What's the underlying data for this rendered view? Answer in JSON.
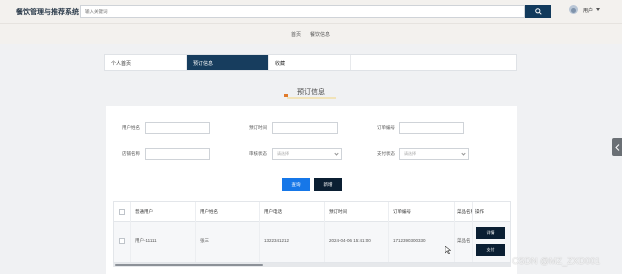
{
  "app": {
    "title": "餐饮管理与推荐系统"
  },
  "search": {
    "placeholder": "输入关键词"
  },
  "user": {
    "name": "用户"
  },
  "nav": {
    "home": "首页",
    "food_info": "餐饮信息"
  },
  "tabs": [
    {
      "label": "个人首页",
      "active": false
    },
    {
      "label": "预订信息",
      "active": true
    },
    {
      "label": "收藏",
      "active": false
    }
  ],
  "section": {
    "title": "预订信息"
  },
  "filters": {
    "username_label": "用户姓名",
    "booking_time_label": "预订时间",
    "order_no_label": "订单编号",
    "restaurant_label": "店铺名称",
    "review_status_label": "审核状态",
    "review_status_placeholder": "请选择",
    "pay_status_label": "支付状态",
    "pay_status_placeholder": "请选择"
  },
  "buttons": {
    "query": "查询",
    "add": "新增"
  },
  "table": {
    "columns": [
      "普通用户",
      "用户姓名",
      "用户电话",
      "预订时间",
      "订单编号",
      "菜品名称",
      "操作"
    ],
    "rows": [
      {
        "user": "用户-11111",
        "name": "张三",
        "phone": "1322341212",
        "time": "2024-04-06 15:41:00",
        "order_no": "1712390300330",
        "dish": "菜品名",
        "actions": [
          "详情",
          "支付"
        ]
      }
    ]
  },
  "watermark": "CSDN @MZ_ZXD001",
  "colors": {
    "primary": "#173d5e",
    "query_button": "#1677e8",
    "dark_button": "#0b1f33",
    "title_flag": "#e07a2b"
  }
}
